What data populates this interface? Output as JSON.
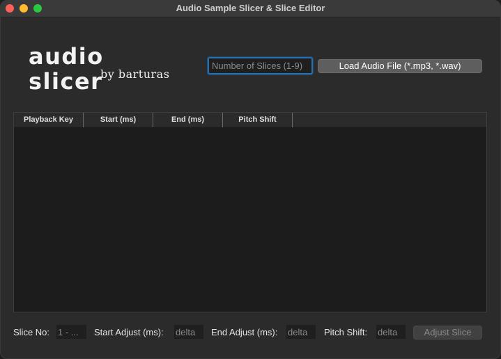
{
  "window": {
    "title": "Audio Sample Slicer & Slice Editor"
  },
  "logo": {
    "main": "audio slicer",
    "sub": "by barturas"
  },
  "controls": {
    "slices_placeholder": "Number of Slices (1-9)",
    "load_label": "Load Audio File (*.mp3, *.wav)"
  },
  "table": {
    "columns": [
      "Playback Key",
      "Start (ms)",
      "End (ms)",
      "Pitch Shift"
    ],
    "rows": []
  },
  "footer": {
    "slice_no_label": "Slice No:",
    "slice_no_placeholder": "1 - ...",
    "start_adjust_label": "Start Adjust (ms):",
    "start_adjust_placeholder": "delta",
    "end_adjust_label": "End Adjust (ms):",
    "end_adjust_placeholder": "delta",
    "pitch_shift_label": "Pitch Shift:",
    "pitch_shift_placeholder": "delta",
    "adjust_label": "Adjust Slice"
  },
  "colors": {
    "window_bg": "#2b2b2b",
    "focus_ring": "#2a6fa8",
    "close": "#fe5f57",
    "minimize": "#febc2e",
    "maximize": "#28c840"
  }
}
